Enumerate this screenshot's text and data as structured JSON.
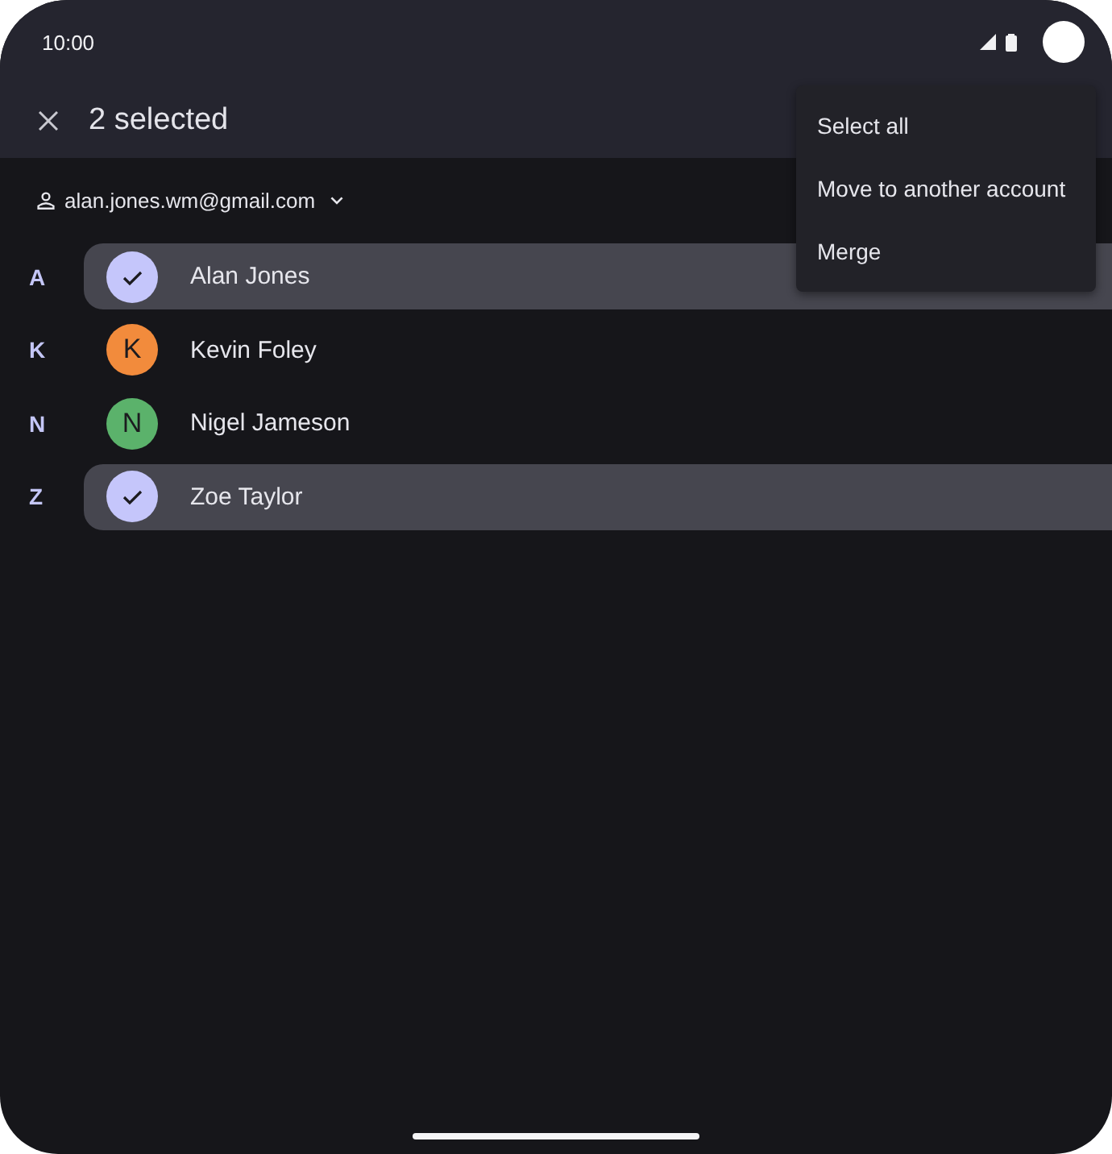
{
  "status_bar": {
    "time": "10:00"
  },
  "header": {
    "title": "2 selected"
  },
  "account": {
    "email": "alan.jones.wm@gmail.com"
  },
  "contacts": [
    {
      "section": "A",
      "name": "Alan Jones",
      "selected": true
    },
    {
      "section": "K",
      "name": "Kevin Foley",
      "selected": false,
      "initial": "K",
      "color": "#f28b3c"
    },
    {
      "section": "N",
      "name": "Nigel Jameson",
      "selected": false,
      "initial": "N",
      "color": "#5bb26b"
    },
    {
      "section": "Z",
      "name": "Zoe Taylor",
      "selected": true
    }
  ],
  "menu": {
    "items": [
      {
        "label": "Select all"
      },
      {
        "label": "Move to another account"
      },
      {
        "label": "Merge"
      }
    ]
  }
}
